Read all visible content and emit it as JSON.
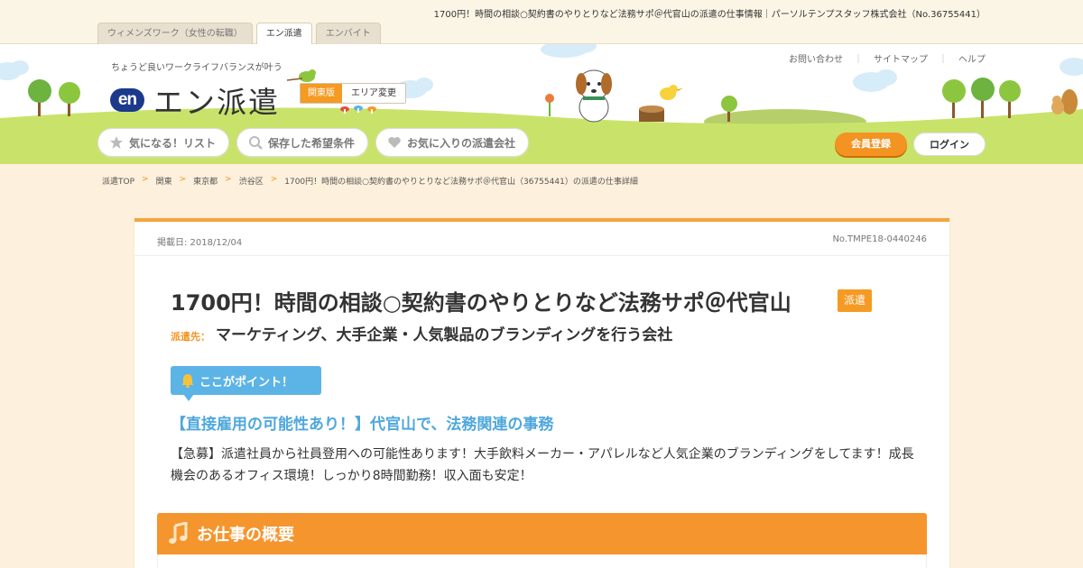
{
  "page": {
    "description": "1700円！時間の相談○契約書のやりとりなど法務サポ＠代官山の派遣の仕事情報｜パーソルテンプスタッフ株式会社（No.36755441）"
  },
  "site_tabs": [
    {
      "label": "ウィメンズワーク（女性の転職）",
      "active": false
    },
    {
      "label": "エン派遣",
      "active": true
    },
    {
      "label": "エンバイト",
      "active": false
    }
  ],
  "header": {
    "tagline": "ちょうど良いワークライフバランスが叶う",
    "logo_mark": "en",
    "logo_text": "エン派遣",
    "area_label": "関東版",
    "area_change": "エリア変更",
    "util_links": [
      "お問い合わせ",
      "サイトマップ",
      "ヘルプ"
    ],
    "util_sep": "｜",
    "nav": [
      {
        "label": "気になる！リスト",
        "icon": "star-icon"
      },
      {
        "label": "保存した希望条件",
        "icon": "search-icon"
      },
      {
        "label": "お気に入りの派遣会社",
        "icon": "heart-icon"
      }
    ],
    "register_label": "会員登録",
    "login_label": "ログイン"
  },
  "breadcrumb": {
    "sep": ">",
    "items": [
      "派遣TOP",
      "関東",
      "東京都",
      "渋谷区",
      "1700円！時間の相談○契約書のやりとりなど法務サポ＠代官山（36755441）の派遣の仕事詳細"
    ]
  },
  "job": {
    "posted": "掲載日: 2018/12/04",
    "number": "No.TMPE18-0440246",
    "title": "1700円！時間の相談○契約書のやりとりなど法務サポ＠代官山",
    "type_badge": "派遣",
    "dest_label": "派遣先：",
    "dest_value": "マーケティング、大手企業・人気製品のブランディングを行う会社",
    "point_label": "ここがポイント！",
    "catch": "【直接雇用の可能性あり！】代官山で、法務関連の事務",
    "description": "【急募】派遣社員から社員登用への可能性あります！大手飲料メーカー・アパレルなど人気企業のブランディングをしてます！成長機会のあるオフィス環境！しっかり8時間勤務！収入面も安定！",
    "section_title": "お仕事の概要"
  },
  "colors": {
    "accent": "#f59a23",
    "blue": "#5cb4e6",
    "grass": "#c9e36a",
    "page_bg": "#fdf0dc"
  }
}
